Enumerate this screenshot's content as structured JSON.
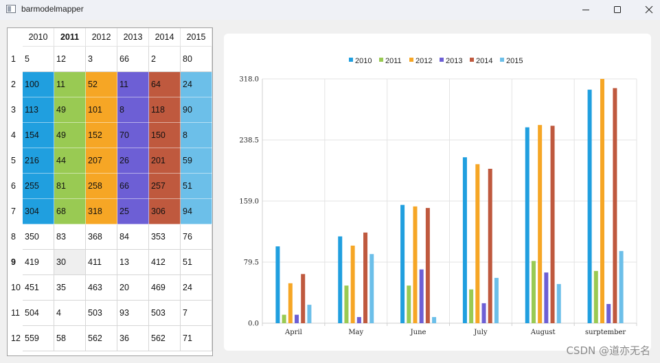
{
  "window": {
    "title": "barmodelmapper"
  },
  "table": {
    "columns": [
      "2010",
      "2011",
      "2012",
      "2013",
      "2014",
      "2015"
    ],
    "bold_column": 1,
    "bold_row": 8,
    "selected_cell": [
      8,
      1
    ],
    "highlight_rows": [
      1,
      2,
      3,
      4,
      5,
      6
    ],
    "rows": [
      {
        "label": "1",
        "cells": [
          "5",
          "12",
          "3",
          "66",
          "2",
          "80"
        ]
      },
      {
        "label": "2",
        "cells": [
          "100",
          "11",
          "52",
          "11",
          "64",
          "24"
        ]
      },
      {
        "label": "3",
        "cells": [
          "113",
          "49",
          "101",
          "8",
          "118",
          "90"
        ]
      },
      {
        "label": "4",
        "cells": [
          "154",
          "49",
          "152",
          "70",
          "150",
          "8"
        ]
      },
      {
        "label": "5",
        "cells": [
          "216",
          "44",
          "207",
          "26",
          "201",
          "59"
        ]
      },
      {
        "label": "6",
        "cells": [
          "255",
          "81",
          "258",
          "66",
          "257",
          "51"
        ]
      },
      {
        "label": "7",
        "cells": [
          "304",
          "68",
          "318",
          "25",
          "306",
          "94"
        ]
      },
      {
        "label": "8",
        "cells": [
          "350",
          "83",
          "368",
          "84",
          "353",
          "76"
        ]
      },
      {
        "label": "9",
        "cells": [
          "419",
          "30",
          "411",
          "13",
          "412",
          "51"
        ]
      },
      {
        "label": "10",
        "cells": [
          "451",
          "35",
          "463",
          "20",
          "469",
          "24"
        ]
      },
      {
        "label": "11",
        "cells": [
          "504",
          "4",
          "503",
          "93",
          "503",
          "7"
        ]
      },
      {
        "label": "12",
        "cells": [
          "559",
          "58",
          "562",
          "36",
          "562",
          "71"
        ]
      }
    ]
  },
  "colors": {
    "2010": "#209fdf",
    "2011": "#99ca53",
    "2012": "#f6a625",
    "2013": "#6d5fd5",
    "2014": "#bf593e",
    "2015": "#6cbfe9"
  },
  "chart_data": {
    "type": "bar",
    "categories": [
      "April",
      "May",
      "June",
      "July",
      "August",
      "surptember"
    ],
    "series": [
      {
        "name": "2010",
        "values": [
          100,
          113,
          154,
          216,
          255,
          304
        ]
      },
      {
        "name": "2011",
        "values": [
          11,
          49,
          49,
          44,
          81,
          68
        ]
      },
      {
        "name": "2012",
        "values": [
          52,
          101,
          152,
          207,
          258,
          318
        ]
      },
      {
        "name": "2013",
        "values": [
          11,
          8,
          70,
          26,
          66,
          25
        ]
      },
      {
        "name": "2014",
        "values": [
          64,
          118,
          150,
          201,
          257,
          306
        ]
      },
      {
        "name": "2015",
        "values": [
          24,
          90,
          8,
          59,
          51,
          94
        ]
      }
    ],
    "yticks": [
      "0.0",
      "79.5",
      "159.0",
      "238.5",
      "318.0"
    ],
    "ylim": [
      0,
      318
    ],
    "grid": true,
    "legend": "top"
  },
  "watermark": "CSDN @道亦无名"
}
